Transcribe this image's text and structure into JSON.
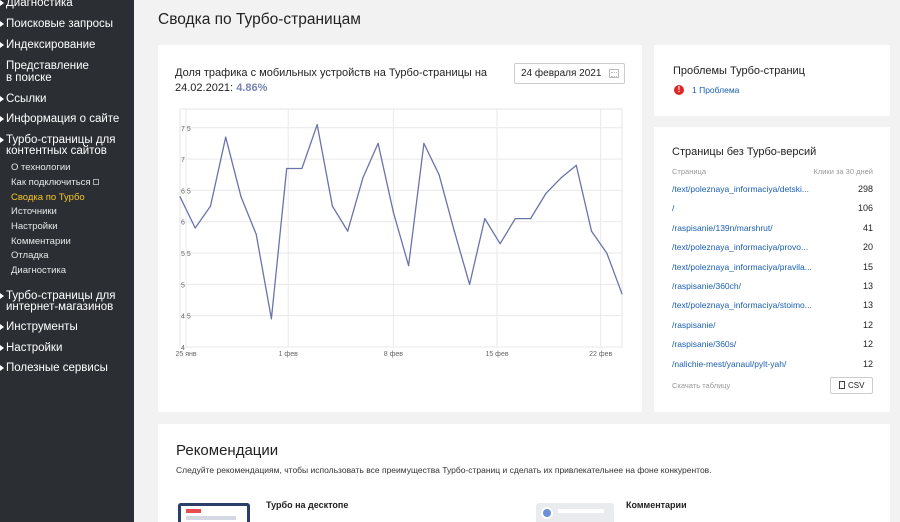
{
  "sidebar": {
    "items": [
      {
        "label": "Диагностика"
      },
      {
        "label": "Поисковые запросы"
      },
      {
        "label": "Индексирование"
      },
      {
        "label_line1": "Представление",
        "label_line2": "в поиске"
      },
      {
        "label": "Ссылки"
      },
      {
        "label": "Информация о сайте"
      },
      {
        "label_line1": "Турбо-страницы для",
        "label_line2": "контентных сайтов"
      },
      {
        "label_line1": "Турбо-страницы для",
        "label_line2": "интернет-магазинов"
      },
      {
        "label": "Инструменты"
      },
      {
        "label": "Настройки"
      },
      {
        "label": "Полезные сервисы"
      }
    ],
    "subitems": [
      {
        "label": "О технологии"
      },
      {
        "label": "Как подключиться"
      },
      {
        "label": "Сводка по Турбо"
      },
      {
        "label": "Источники"
      },
      {
        "label": "Настройки"
      },
      {
        "label": "Комментарии"
      },
      {
        "label": "Отладка"
      },
      {
        "label": "Диагностика"
      }
    ],
    "active_color": "#f5c527"
  },
  "page_title": "Сводка по Турбо-страницам",
  "traffic": {
    "title": "Доля трафика с мобильных устройств на Турбо-страницы на 24.02.2021:",
    "value": "4.86%",
    "date": "24 февраля 2021"
  },
  "chart_data": {
    "type": "line",
    "y_ticks": [
      "7.5",
      "7",
      "6.5",
      "6",
      "5.5",
      "5",
      "4.5",
      "4"
    ],
    "x_ticks": [
      "25 янв",
      "1 фев",
      "8 фев",
      "15 фев",
      "22 фев"
    ],
    "ylim": [
      4,
      7.8
    ],
    "x": [
      0,
      1,
      2,
      3,
      4,
      5,
      6,
      7,
      8,
      9,
      10,
      11,
      12,
      13,
      14,
      15,
      16,
      17,
      18,
      19,
      20,
      21,
      22,
      23,
      24,
      25,
      26,
      27,
      28,
      29,
      30
    ],
    "values": [
      6.4,
      5.9,
      6.25,
      7.35,
      6.4,
      5.8,
      4.45,
      6.85,
      6.85,
      7.55,
      6.25,
      5.85,
      6.7,
      7.25,
      6.15,
      5.3,
      7.25,
      6.75,
      5.85,
      5.0,
      6.05,
      5.65,
      6.05,
      6.05,
      6.45,
      6.7,
      6.9,
      5.85,
      5.5,
      4.85
    ],
    "color": "#6b73ab",
    "grid": true
  },
  "problems": {
    "title": "Проблемы Турбо-страниц",
    "count_label": "1 Проблема",
    "icon": "!"
  },
  "pages_without_turbo": {
    "title": "Страницы без Турбо-версий",
    "col_page": "Страница",
    "col_clicks": "Клики за 30 дней",
    "rows": [
      {
        "page": "/text/poleznaya_informaciya/detski...",
        "clicks": "298"
      },
      {
        "page": "/",
        "clicks": "106"
      },
      {
        "page": "/raspisanie/139n/marshrut/",
        "clicks": "41"
      },
      {
        "page": "/text/poleznaya_informaciya/provo...",
        "clicks": "20"
      },
      {
        "page": "/text/poleznaya_informaciya/pravila...",
        "clicks": "15"
      },
      {
        "page": "/raspisanie/360ch/",
        "clicks": "13"
      },
      {
        "page": "/text/poleznaya_informaciya/stoimo...",
        "clicks": "13"
      },
      {
        "page": "/raspisanie/",
        "clicks": "12"
      },
      {
        "page": "/raspisanie/360s/",
        "clicks": "12"
      },
      {
        "page": "/nalichie-mest/yanaul/pylt-yah/",
        "clicks": "12"
      }
    ],
    "download_label": "Скачать таблицу",
    "csv_label": "CSV"
  },
  "recommendations": {
    "title": "Рекомендации",
    "subtitle": "Следуйте рекомендациям, чтобы использовать все преимущества Турбо-страниц и сделать их привлекательнее на фоне конкурентов.",
    "items": [
      {
        "title": "Турбо на десктопе"
      },
      {
        "title": "Комментарии"
      }
    ]
  }
}
